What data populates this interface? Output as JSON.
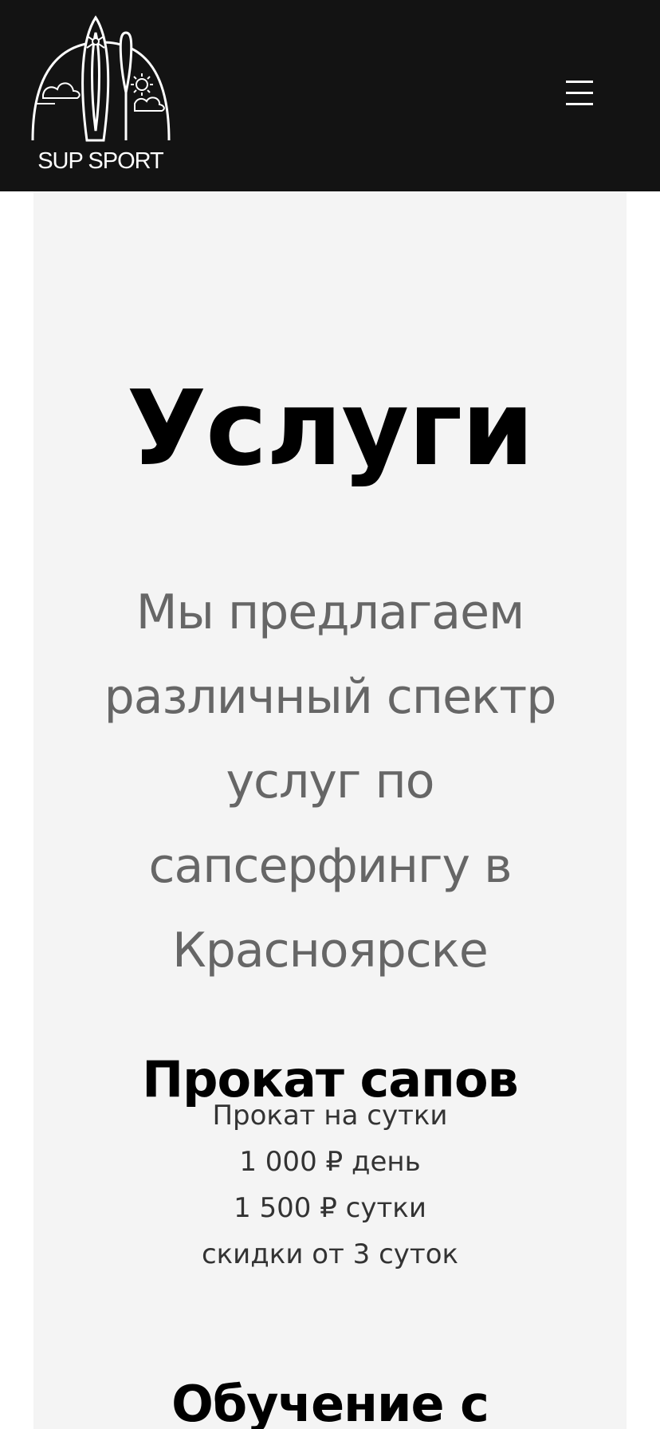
{
  "header": {
    "logo_text": "SUP SPORT",
    "menu_icon": "hamburger-menu-icon"
  },
  "services": {
    "title": "Услуги",
    "subtitle": "Мы предлагаем различный спектр услуг по сапсерфингу в Красноярске",
    "rental": {
      "title": "Прокат сапов",
      "lines": [
        "Прокат на сутки",
        "1 000 ₽ день",
        "1 500 ₽ сутки",
        "скидки от 3 суток"
      ]
    },
    "training": {
      "title": "Обучение с"
    }
  },
  "colors": {
    "header_background": "#131313",
    "card_background": "#f4f4f4",
    "subtitle_text": "#666666"
  }
}
